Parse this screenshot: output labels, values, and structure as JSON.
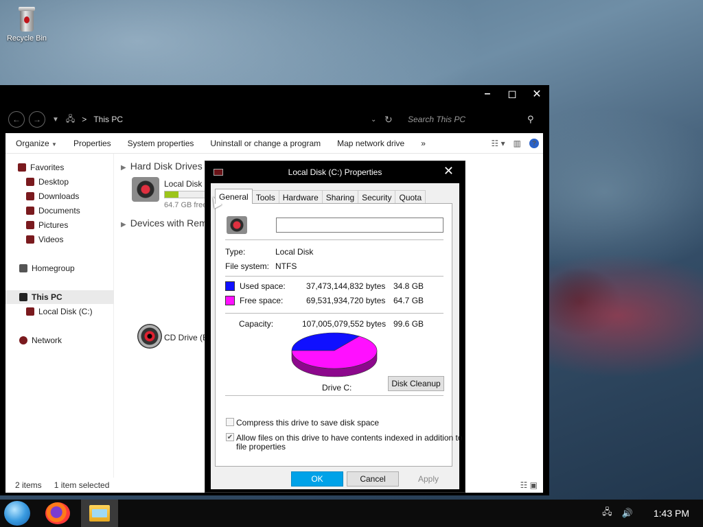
{
  "desktop": {
    "icons": [
      {
        "label": "Recycle Bin",
        "icon": "recycle-bin-icon"
      }
    ]
  },
  "explorer": {
    "window_controls": {
      "minimize": "–",
      "maximize": "◻",
      "close": "✕"
    },
    "address": {
      "back": "←",
      "forward": "→",
      "separator": ">",
      "location": "This PC",
      "search_placeholder": "Search This PC"
    },
    "commands": [
      "Organize",
      "Properties",
      "System properties",
      "Uninstall or change a program",
      "Map network drive",
      "»"
    ],
    "sidebar": {
      "favorites": "Favorites",
      "favorite_items": [
        "Desktop",
        "Downloads",
        "Documents",
        "Pictures",
        "Videos"
      ],
      "homegroup": "Homegroup",
      "this_pc": "This PC",
      "this_pc_items": [
        "Local Disk (C:)"
      ],
      "network": "Network"
    },
    "content": {
      "group_hdd": "Hard Disk Drives (",
      "drive_c_name": "Local Disk (C",
      "drive_c_free": "64.7 GB free",
      "drive_c_used_fraction": 0.35,
      "group_removable": "Devices with Rem",
      "drive_e_name": "CD Drive (E:"
    },
    "status": {
      "items": "2 items",
      "selected": "1 item selected"
    }
  },
  "dialog": {
    "title": "Local Disk (C:) Properties",
    "close": "✕",
    "tabs": [
      "General",
      "Tools",
      "Hardware",
      "Sharing",
      "Security",
      "Quota"
    ],
    "active_tab": "General",
    "name_value": "",
    "type_label": "Type:",
    "type_value": "Local Disk",
    "fs_label": "File system:",
    "fs_value": "NTFS",
    "used_label": "Used space:",
    "used_bytes": "37,473,144,832 bytes",
    "used_gb": "34.8 GB",
    "free_label": "Free space:",
    "free_bytes": "69,531,934,720 bytes",
    "free_gb": "64.7 GB",
    "capacity_label": "Capacity:",
    "capacity_bytes": "107,005,079,552 bytes",
    "capacity_gb": "99.6 GB",
    "drive_label": "Drive C:",
    "disk_cleanup": "Disk Cleanup",
    "compress_label": "Compress this drive to save disk space",
    "compress_checked": false,
    "index_label_1": "Allow files on this drive to have contents indexed in addition to",
    "index_label_2": "file properties",
    "index_checked": true,
    "ok": "OK",
    "cancel": "Cancel",
    "apply": "Apply",
    "colors": {
      "used": "#1010ff",
      "free": "#ff10ff"
    }
  },
  "chart_data": {
    "type": "pie",
    "labels": [
      "Used space",
      "Free space"
    ],
    "values": [
      34.8,
      64.7
    ],
    "colors": [
      "#1010ff",
      "#ff10ff"
    ]
  },
  "taskbar": {
    "time": "1:43 PM",
    "tray_icons": [
      "network-icon",
      "volume-icon"
    ]
  }
}
